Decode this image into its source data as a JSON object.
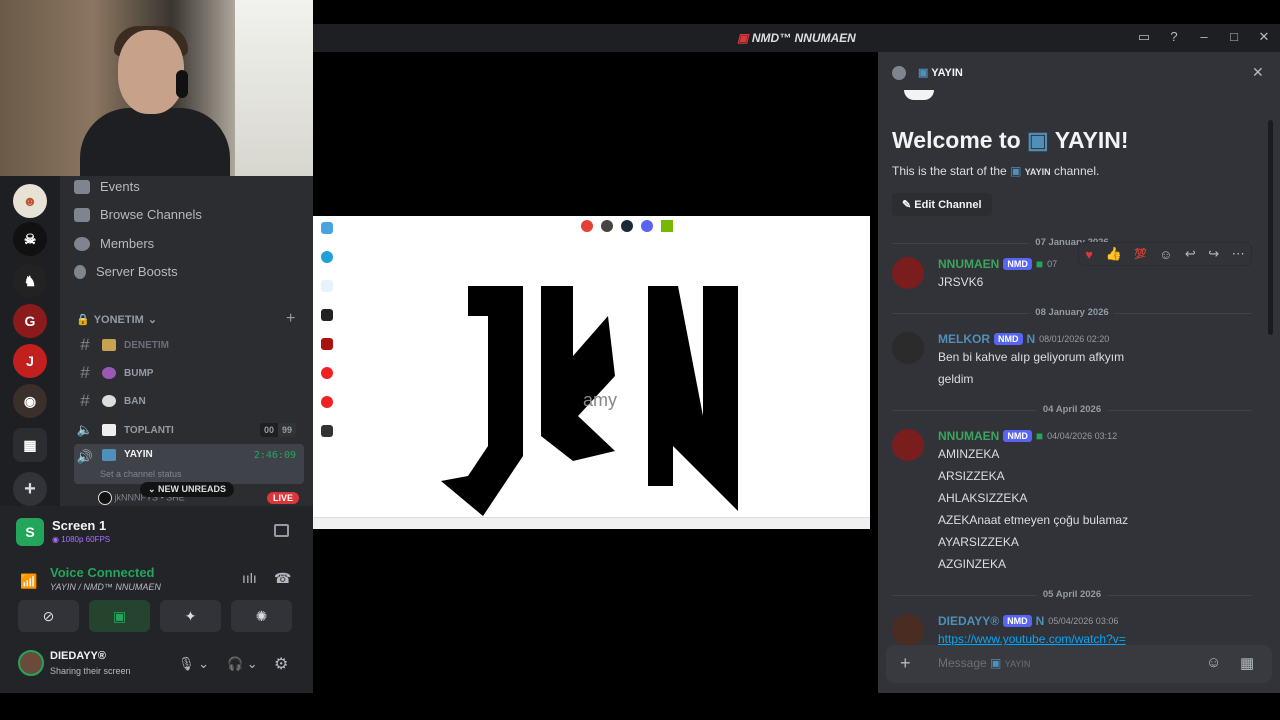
{
  "window": {
    "title": "NMD™ NNUMAEN"
  },
  "sidebar": {
    "nav": [
      {
        "label": "Events"
      },
      {
        "label": "Browse Channels"
      },
      {
        "label": "Members"
      },
      {
        "label": "Server Boosts"
      }
    ],
    "category": "YONETIM",
    "channels": [
      {
        "label": "DENETIM"
      },
      {
        "label": "BUMP"
      },
      {
        "label": "BAN"
      },
      {
        "label": "TOPLANTI",
        "count_a": "00",
        "count_b": "99"
      },
      {
        "label": "YAYIN",
        "timer": "2:46:09",
        "status_placeholder": "Set a channel status"
      }
    ],
    "member_preview": "jkNNNFYS • SHE",
    "live_badge": "LIVE",
    "new_unreads": "NEW UNREADS"
  },
  "stream_panel": {
    "title": "Screen 1",
    "subtitle": "1080p 60FPS",
    "voice_status": "Voice Connected",
    "voice_channel": "YAYIN / NMD™ NNUMAEN"
  },
  "user": {
    "name": "DIEDAYY®",
    "status": "Sharing their screen"
  },
  "chat": {
    "channel_name": "YAYIN",
    "welcome_prefix": "Welcome to",
    "welcome_channel": "YAYIN!",
    "start_prefix": "This is the start of the",
    "start_channel": "YAYIN",
    "start_suffix": "channel.",
    "edit_channel": "Edit Channel",
    "message_placeholder": "Message",
    "message_channel": "YAYIN",
    "dates": [
      "07 January 2026",
      "08 January 2026",
      "04 April 2026",
      "05 April 2026"
    ],
    "messages": [
      {
        "author": "NNUMAEN",
        "tag": "NMD",
        "time": "07",
        "lines": [
          "JRSVK6"
        ],
        "color": "#3ba55d"
      },
      {
        "author": "MELKOR",
        "tag": "NMD",
        "time": "08/01/2026 02:20",
        "lines": [
          "Ben bi kahve alıp geliyorum afkyım",
          "geldim"
        ],
        "color": "#4f8fba"
      },
      {
        "author": "NNUMAEN",
        "tag": "NMD",
        "time": "04/04/2026 03:12",
        "lines": [
          "AMINZEKA",
          "ARSIZZEKA",
          "AHLAKSIZZEKA",
          "AZEKAnaat etmeyen çoğu bulamaz",
          "AYARSIZZEKA",
          "AZGINZEKA"
        ],
        "color": "#3ba55d"
      },
      {
        "author": "DIEDAYY®",
        "tag": "NMD",
        "time": "05/04/2026 03:06",
        "lines": [
          "https://www.youtube.com/watch?v="
        ],
        "color": "#4f8fba"
      }
    ]
  },
  "stream": {
    "logo_text": "jKN",
    "watermark": "amy"
  },
  "colors": {
    "accent": "#5865f2",
    "online": "#23a55a",
    "live": "#da373c",
    "bg": "#313338"
  }
}
